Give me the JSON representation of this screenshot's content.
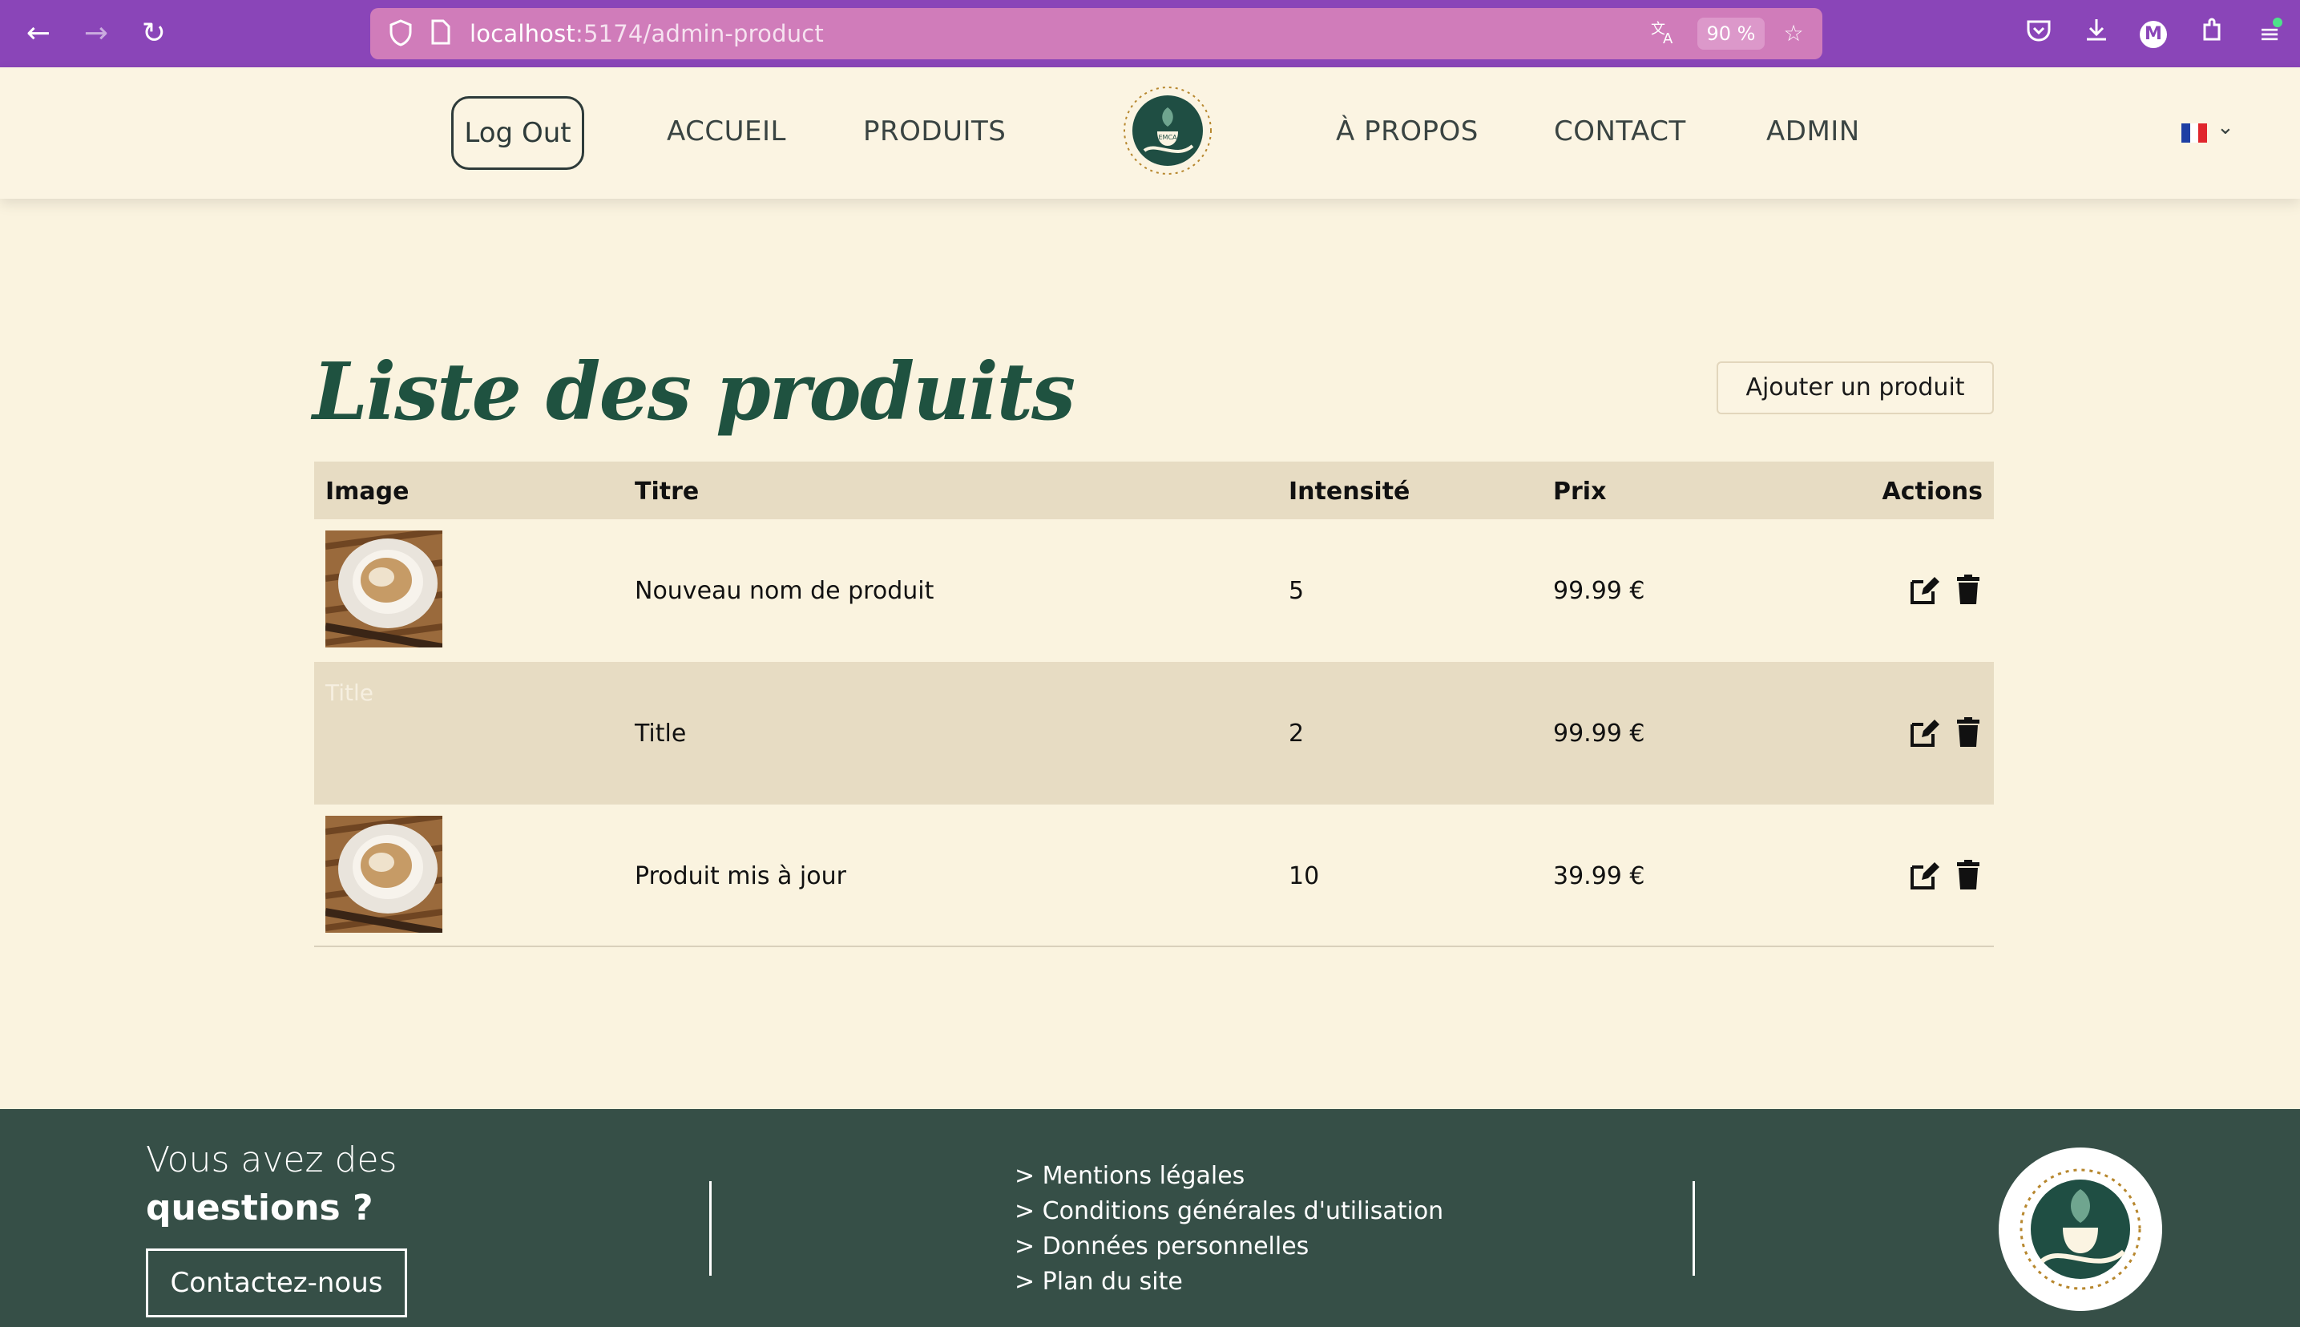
{
  "browser": {
    "url_host": "localhost",
    "url_path": ":5174/admin-product",
    "zoom": "90 %",
    "profile_initial": "M"
  },
  "header": {
    "logout_label": "Log Out",
    "nav": [
      {
        "label": "ACCUEIL"
      },
      {
        "label": "PRODUITS"
      },
      {
        "label": "À PROPOS"
      },
      {
        "label": "CONTACT"
      },
      {
        "label": "ADMIN"
      }
    ],
    "logo_text": "EMPORIO DU CAFE",
    "logo_short": "EMCA",
    "language": "fr"
  },
  "main": {
    "title": "Liste des produits",
    "add_button": "Ajouter un produit",
    "columns": [
      "Image",
      "Titre",
      "Intensité",
      "Prix",
      "Actions"
    ],
    "rows": [
      {
        "image": "coffee-cup",
        "title": "Nouveau nom de produit",
        "intensity": "5",
        "price": "99.99 €"
      },
      {
        "image_alt": "Title",
        "title": "Title",
        "intensity": "2",
        "price": "99.99 €"
      },
      {
        "image": "coffee-cup",
        "title": "Produit mis à jour",
        "intensity": "10",
        "price": "39.99 €"
      }
    ]
  },
  "footer": {
    "question_line1": "Vous avez des",
    "question_line2": "questions ?",
    "contact_button": "Contactez-nous",
    "links": [
      "> Mentions légales",
      "> Conditions générales d'utilisation",
      "> Données personnelles",
      "> Plan du site"
    ]
  },
  "colors": {
    "browser_bar": "#8a45b8",
    "url_bar": "#d07cba",
    "page_bg": "#faf3df",
    "table_header": "#e7dcc3",
    "title_green": "#1f5240",
    "footer_bg": "#364f47"
  },
  "icons": [
    "back-arrow-icon",
    "forward-arrow-icon",
    "reload-icon",
    "shield-icon",
    "page-icon",
    "translate-icon",
    "star-icon",
    "pocket-icon",
    "download-icon",
    "extensions-icon",
    "menu-icon",
    "edit-icon",
    "trash-icon",
    "chevron-down-icon"
  ]
}
